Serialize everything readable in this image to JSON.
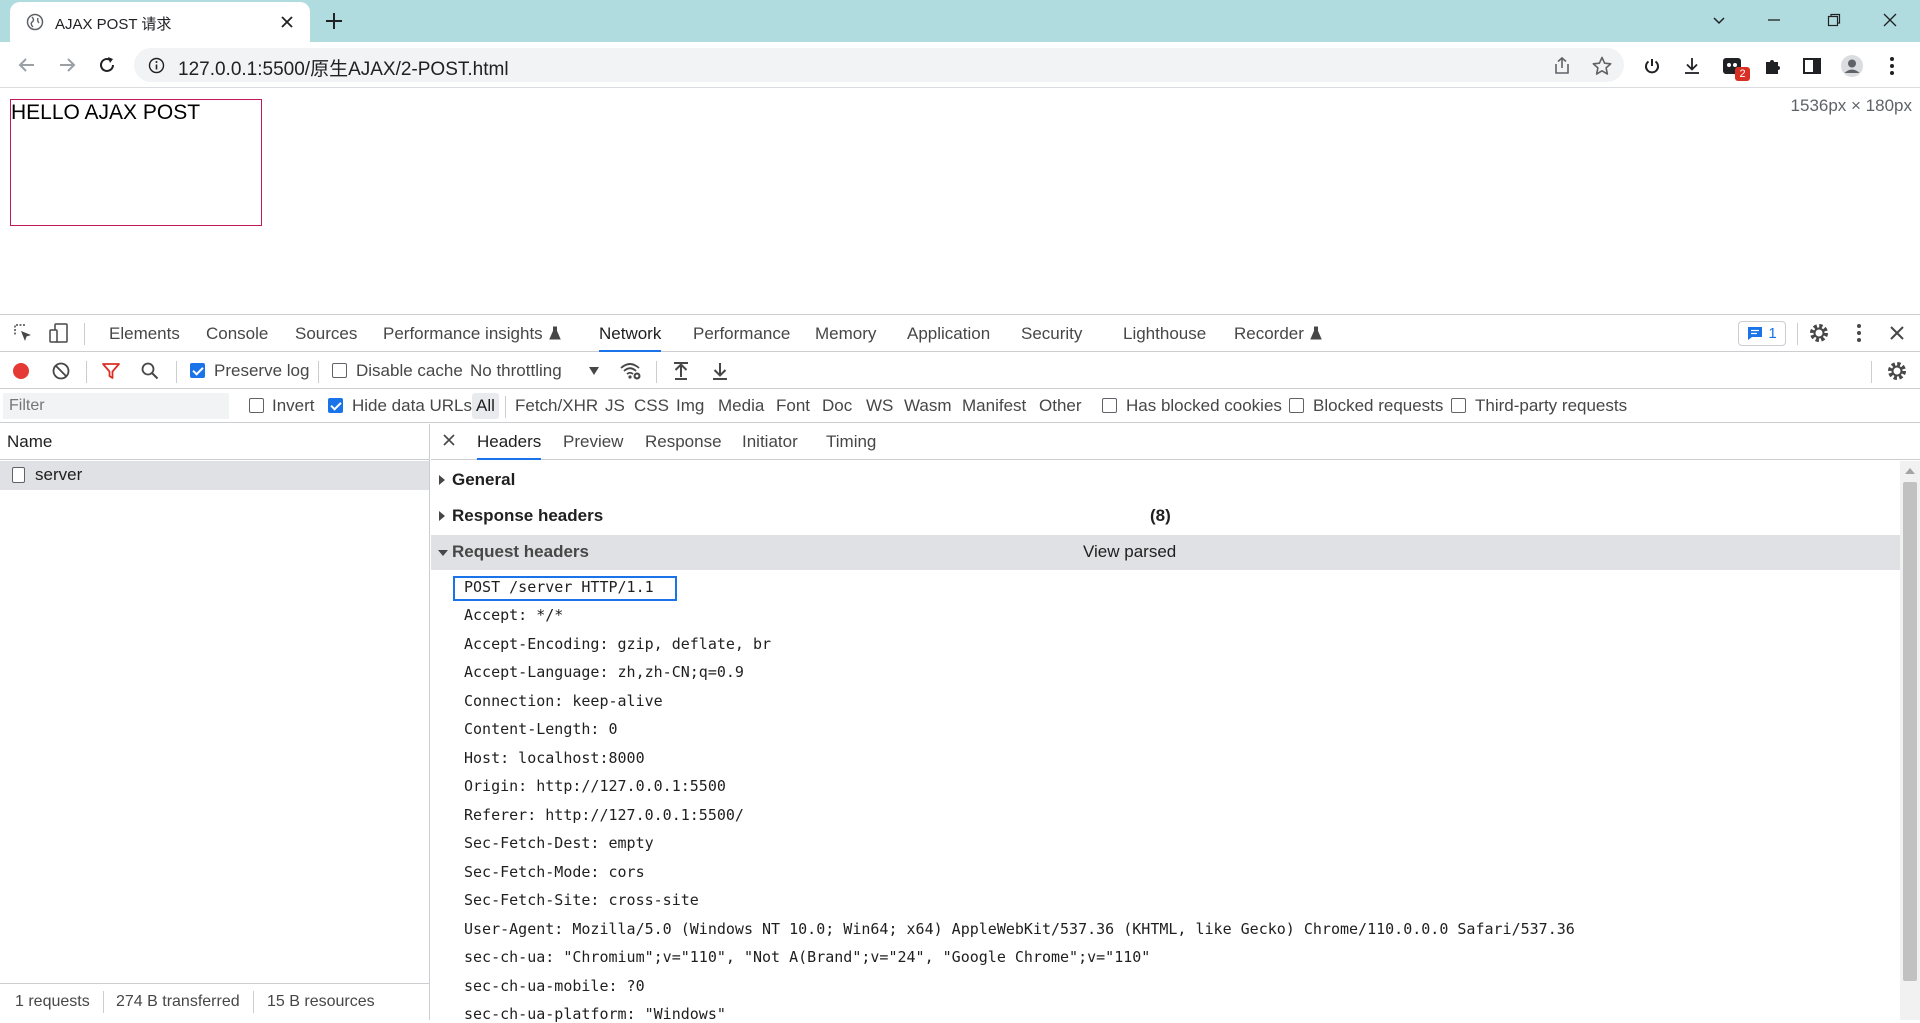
{
  "browser": {
    "tab_title": "AJAX POST 请求",
    "url": "127.0.0.1:5500/原生AJAX/2-POST.html",
    "extension_badge": "2"
  },
  "page": {
    "box_text": "HELLO AJAX POST",
    "viewport_size": "1536px × 180px"
  },
  "devtools": {
    "tabs": [
      "Elements",
      "Console",
      "Sources",
      "Performance insights",
      "Network",
      "Performance",
      "Memory",
      "Application",
      "Security",
      "Lighthouse",
      "Recorder"
    ],
    "active_tab": "Network",
    "issues_count": "1",
    "network_toolbar": {
      "preserve_log_label": "Preserve log",
      "preserve_log_checked": true,
      "disable_cache_label": "Disable cache",
      "disable_cache_checked": false,
      "throttling_value": "No throttling"
    },
    "filter_bar": {
      "filter_placeholder": "Filter",
      "invert_label": "Invert",
      "hide_data_urls_label": "Hide data URLs",
      "type_filters": [
        "All",
        "Fetch/XHR",
        "JS",
        "CSS",
        "Img",
        "Media",
        "Font",
        "Doc",
        "WS",
        "Wasm",
        "Manifest",
        "Other"
      ],
      "active_type": "All",
      "has_blocked_cookies_label": "Has blocked cookies",
      "blocked_requests_label": "Blocked requests",
      "third_party_label": "Third-party requests"
    },
    "request_list": {
      "column_name": "Name",
      "rows": [
        {
          "name": "server"
        }
      ]
    },
    "status_bar": {
      "requests": "1 requests",
      "transferred": "274 B transferred",
      "resources": "15 B resources"
    },
    "detail": {
      "tabs": [
        "Headers",
        "Preview",
        "Response",
        "Initiator",
        "Timing"
      ],
      "active_tab": "Headers",
      "general_label": "General",
      "response_headers_label": "Response headers",
      "response_headers_count": "(8)",
      "request_headers_label": "Request headers",
      "view_parsed_label": "View parsed",
      "raw_request_lines": [
        "POST /server HTTP/1.1",
        "Accept: */*",
        "Accept-Encoding: gzip, deflate, br",
        "Accept-Language: zh,zh-CN;q=0.9",
        "Connection: keep-alive",
        "Content-Length: 0",
        "Host: localhost:8000",
        "Origin: http://127.0.0.1:5500",
        "Referer: http://127.0.0.1:5500/",
        "Sec-Fetch-Dest: empty",
        "Sec-Fetch-Mode: cors",
        "Sec-Fetch-Site: cross-site",
        "User-Agent: Mozilla/5.0 (Windows NT 10.0; Win64; x64) AppleWebKit/537.36 (KHTML, like Gecko) Chrome/110.0.0.0 Safari/537.36",
        "sec-ch-ua: \"Chromium\";v=\"110\", \"Not A(Brand\";v=\"24\", \"Google Chrome\";v=\"110\"",
        "sec-ch-ua-mobile: ?0",
        "sec-ch-ua-platform: \"Windows\""
      ]
    }
  },
  "colors": {
    "tabstrip": "#b1dcdf",
    "accent": "#1a73e8",
    "record": "#e53935",
    "page_box_border": "#c2185b"
  }
}
